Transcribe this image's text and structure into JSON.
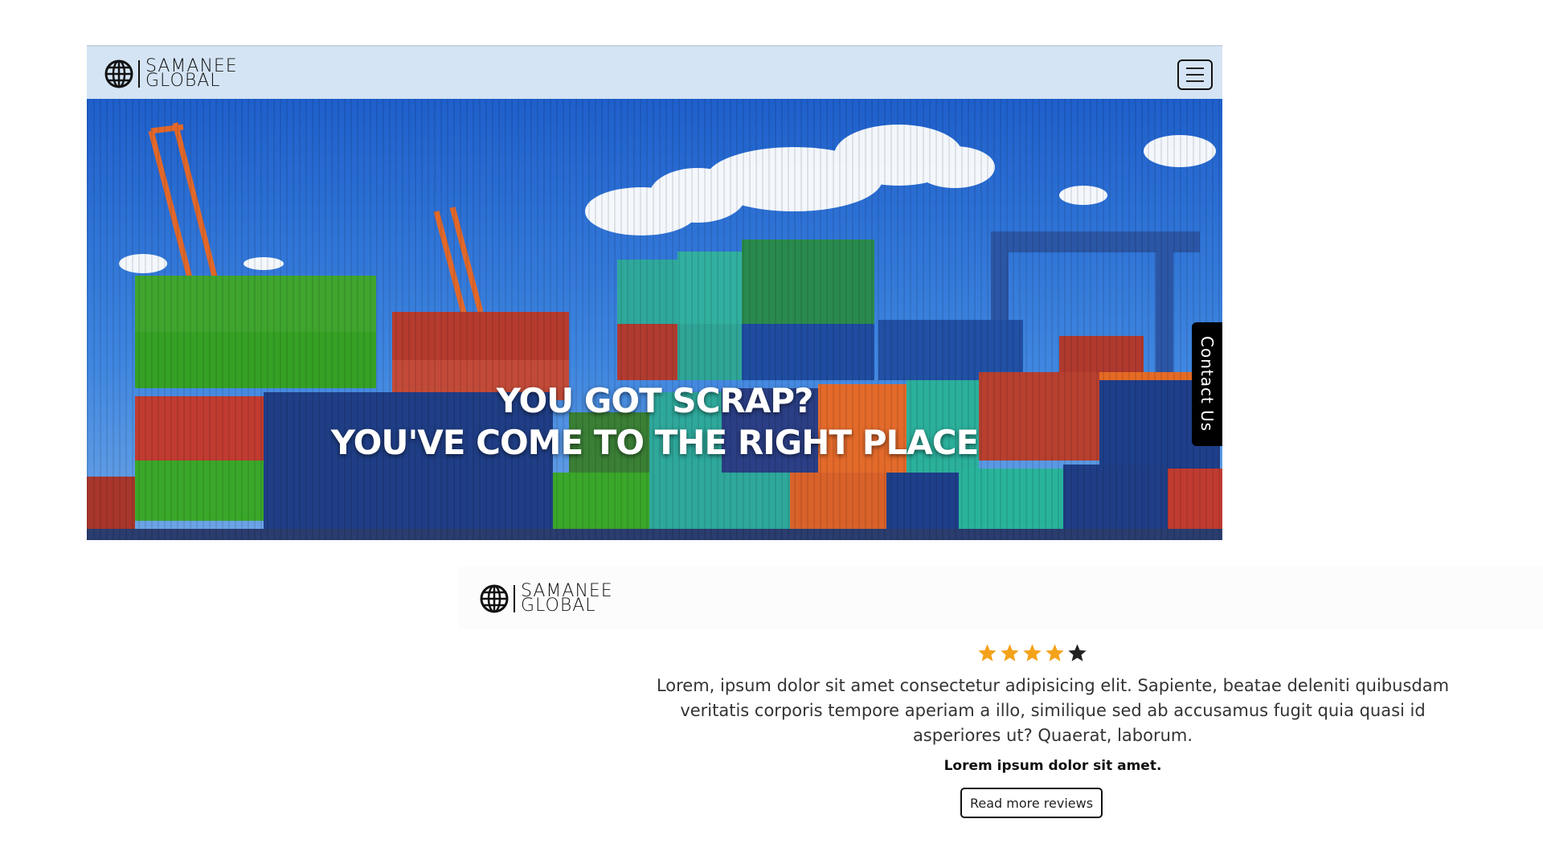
{
  "brand": {
    "line1": "SAMANEE",
    "line2": "GLOBAL"
  },
  "navbar": {
    "menu_icon": "hamburger-icon"
  },
  "hero": {
    "headline_line1": "YOU GOT SCRAP?",
    "headline_line2": "YOU'VE COME TO THE RIGHT PLACE",
    "contact_tab": "Contact Us"
  },
  "review": {
    "rating": 4,
    "rating_max": 5,
    "text": "Lorem, ipsum dolor sit amet consectetur adipisicing elit. Sapiente, beatae deleniti quibusdam veritatis corporis tempore aperiam a illo, similique sed ab accusamus fugit quia quasi id asperiores ut? Quaerat, laborum.",
    "author": "Lorem ipsum dolor sit amet.",
    "button_label": "Read more reviews"
  },
  "colors": {
    "star_filled": "#f4a21a",
    "star_empty": "#222222",
    "navbar_bg": "#d4e4f4"
  }
}
